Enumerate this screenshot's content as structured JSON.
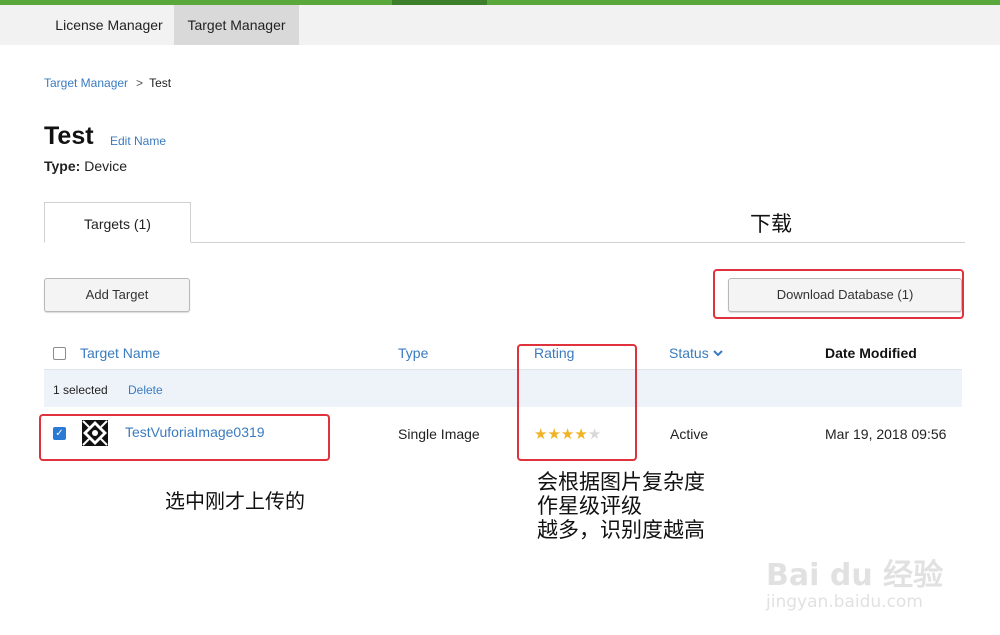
{
  "nav": {
    "tabs": [
      {
        "label": "License Manager"
      },
      {
        "label": "Target Manager"
      }
    ]
  },
  "breadcrumb": {
    "parent": "Target Manager",
    "separator": ">",
    "current": "Test"
  },
  "header": {
    "title": "Test",
    "edit_link": "Edit Name",
    "type_label": "Type:",
    "type_value": "Device"
  },
  "tabs": [
    {
      "label": "Targets (1)"
    }
  ],
  "toolbar": {
    "add_label": "Add Target",
    "download_label": "Download Database (1)"
  },
  "table": {
    "columns": {
      "name": "Target Name",
      "type": "Type",
      "rating": "Rating",
      "status": "Status",
      "date": "Date Modified"
    },
    "selection": {
      "count": "1 selected",
      "delete": "Delete"
    },
    "rows": [
      {
        "name": "TestVuforiaImage0319",
        "type": "Single Image",
        "rating": 4,
        "rating_max": 5,
        "status": "Active",
        "date": "Mar 19, 2018 09:56"
      }
    ]
  },
  "annotations": {
    "download": "下载",
    "selected": "选中刚才上传的",
    "rating_line1": "会根据图片复杂度",
    "rating_line2": "作星级评级",
    "rating_line3": "越多，识别度越高"
  },
  "watermark": {
    "brand": "Bai du 经验",
    "url": "jingyan.baidu.com"
  },
  "colors": {
    "accent": "#5aa83c",
    "link": "#3a7bbf",
    "annotation": "#e0323c",
    "star": "#f0b323"
  }
}
